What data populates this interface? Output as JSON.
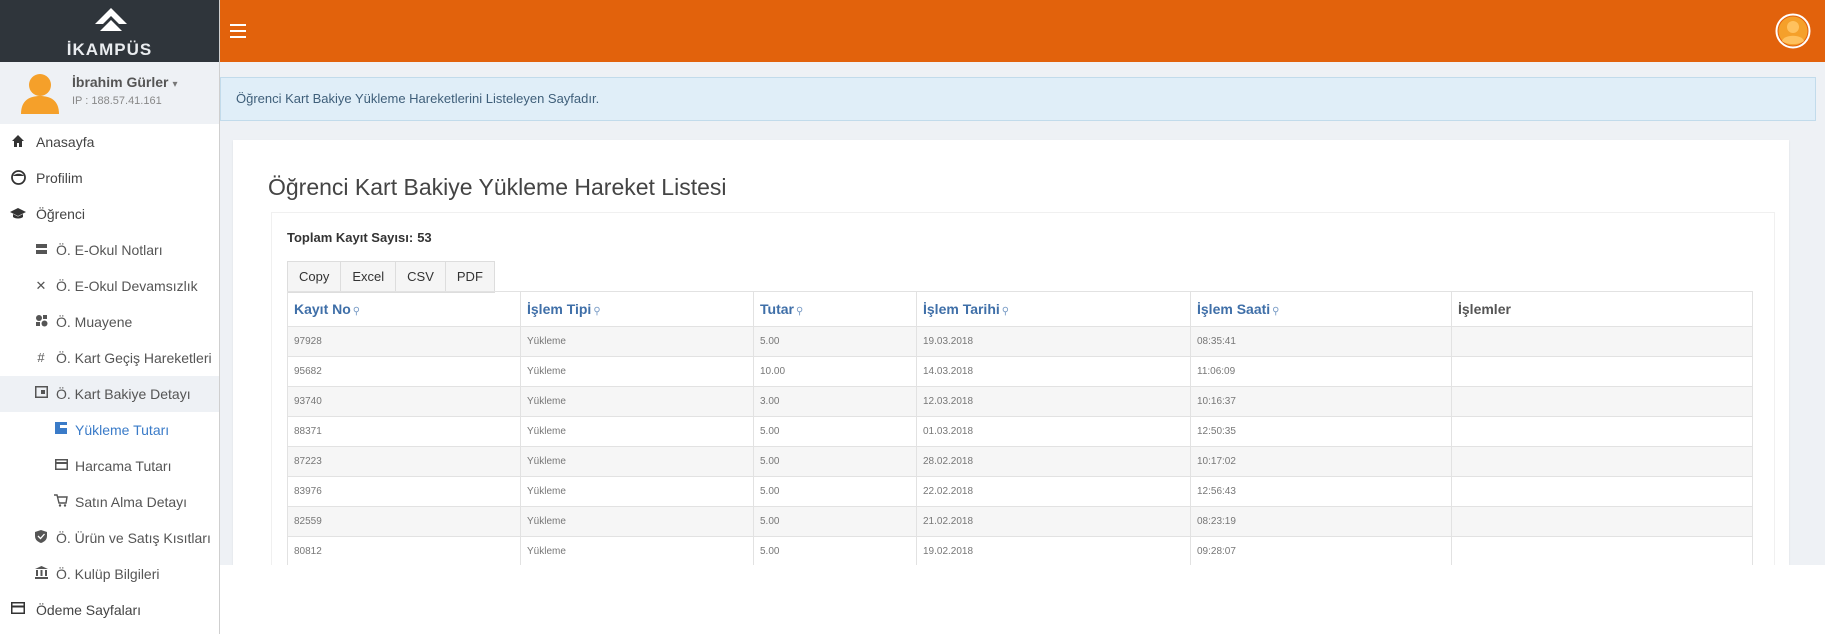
{
  "brand": {
    "name": "İKAMPÜS"
  },
  "user": {
    "name": "İbrahim Gürler",
    "ip": "IP : 188.57.41.161"
  },
  "sidebar": {
    "items": [
      {
        "label": "Anasayfa",
        "icon": "home-icon"
      },
      {
        "label": "Profilim",
        "icon": "smiley-icon"
      },
      {
        "label": "Öğrenci",
        "icon": "graduation-cap-icon"
      },
      {
        "label": "Ö. E-Okul Notları",
        "icon": "list-icon"
      },
      {
        "label": "Ö. E-Okul Devamsızlık",
        "icon": "close-icon"
      },
      {
        "label": "Ö. Muayene",
        "icon": "medical-icon"
      },
      {
        "label": "Ö. Kart Geçiş Hareketleri",
        "icon": "hashtag-icon"
      },
      {
        "label": "Ö. Kart Bakiye Detayı",
        "icon": "wallet-icon"
      },
      {
        "label": "Yükleme Tutarı",
        "icon": "card-load-icon"
      },
      {
        "label": "Harcama Tutarı",
        "icon": "credit-card-icon"
      },
      {
        "label": "Satın Alma Detayı",
        "icon": "cart-icon"
      },
      {
        "label": "Ö. Ürün ve Satış Kısıtları",
        "icon": "shield-icon"
      },
      {
        "label": "Ö. Kulüp Bilgileri",
        "icon": "bank-icon"
      },
      {
        "label": "Ödeme Sayfaları",
        "icon": "credit-card-icon"
      }
    ]
  },
  "notice": "Öğrenci Kart Bakiye Yükleme Hareketlerini Listeleyen Sayfadır.",
  "page": {
    "title": "Öğrenci Kart Bakiye Yükleme Hareket Listesi",
    "total_label": "Toplam Kayıt Sayısı:",
    "total_value": "53"
  },
  "export_buttons": [
    "Copy",
    "Excel",
    "CSV",
    "PDF"
  ],
  "table": {
    "columns": [
      "Kayıt No",
      "İşlem Tipi",
      "Tutar",
      "İşlem Tarihi",
      "İşlem Saati",
      "İşlemler"
    ],
    "rows": [
      [
        "97928",
        "Yükleme",
        "5.00",
        "19.03.2018",
        "08:35:41",
        ""
      ],
      [
        "95682",
        "Yükleme",
        "10.00",
        "14.03.2018",
        "11:06:09",
        ""
      ],
      [
        "93740",
        "Yükleme",
        "3.00",
        "12.03.2018",
        "10:16:37",
        ""
      ],
      [
        "88371",
        "Yükleme",
        "5.00",
        "01.03.2018",
        "12:50:35",
        ""
      ],
      [
        "87223",
        "Yükleme",
        "5.00",
        "28.02.2018",
        "10:17:02",
        ""
      ],
      [
        "83976",
        "Yükleme",
        "5.00",
        "22.02.2018",
        "12:56:43",
        ""
      ],
      [
        "82559",
        "Yükleme",
        "5.00",
        "21.02.2018",
        "08:23:19",
        ""
      ],
      [
        "80812",
        "Yükleme",
        "5.00",
        "19.02.2018",
        "09:28:07",
        ""
      ]
    ]
  },
  "colors": {
    "header": "#e2620c",
    "sidebar_logo": "#2f353b",
    "link": "#3f6fa8",
    "accent": "#3a7bc8"
  }
}
